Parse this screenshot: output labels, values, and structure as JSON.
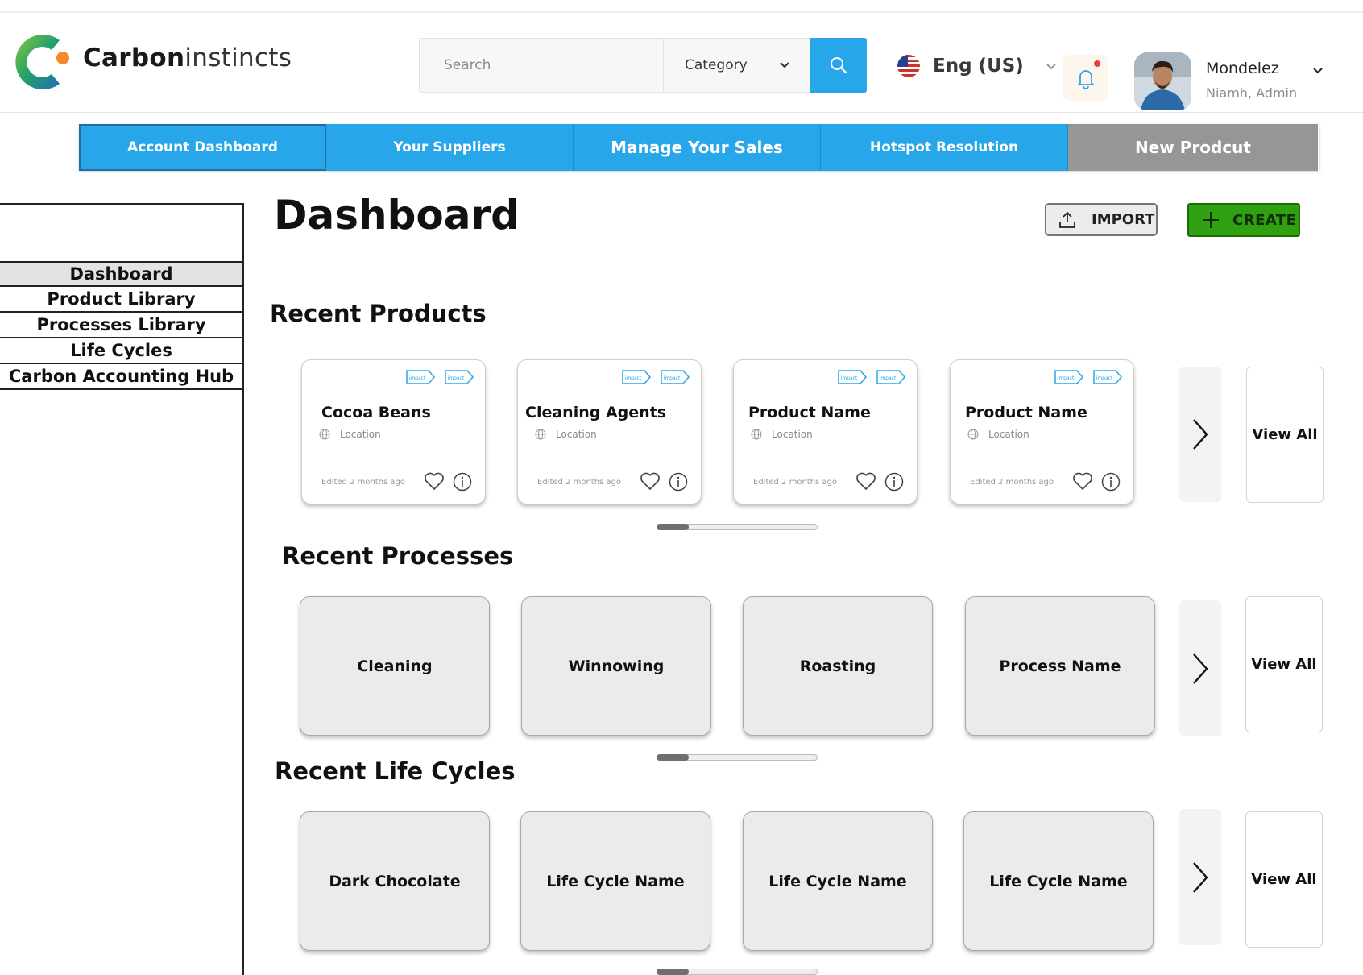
{
  "app": {
    "brand_bold": "Carbon",
    "brand_light": "instincts",
    "colors": {
      "primary": "#28a6ea",
      "create": "#2fa00f",
      "grey_tab": "#969696"
    }
  },
  "header": {
    "search": {
      "placeholder": "Search",
      "category_label": "Category"
    },
    "language": {
      "label": "Eng (US)",
      "flag_icon": "us-flag-icon"
    },
    "notifications": {
      "icon": "bell-icon",
      "has_unread": true
    },
    "user": {
      "name": "Mondelez",
      "role": "Niamh, Admin"
    }
  },
  "nav": {
    "tabs": [
      {
        "label": "Account Dashboard"
      },
      {
        "label": "Your Suppliers"
      },
      {
        "label": "Manage Your Sales"
      },
      {
        "label": "Hotspot Resolution"
      },
      {
        "label": "New Prodcut"
      }
    ]
  },
  "sidebar": {
    "items": [
      {
        "label": "Dashboard"
      },
      {
        "label": "Product Library"
      },
      {
        "label": "Processes Library"
      },
      {
        "label": "Life Cycles"
      },
      {
        "label": "Carbon Accounting Hub"
      }
    ]
  },
  "main": {
    "title": "Dashboard",
    "import_label": "IMPORT",
    "create_label": "CREATE",
    "view_all_label": "View All",
    "recent_products": {
      "title": "Recent Products",
      "tag_label": "impact",
      "items": [
        {
          "name": "Cocoa Beans",
          "location": "Location",
          "edited": "Edited 2 months ago"
        },
        {
          "name": "Cleaning Agents",
          "location": "Location",
          "edited": "Edited 2 months ago"
        },
        {
          "name": "Product Name",
          "location": "Location",
          "edited": "Edited 2 months ago"
        },
        {
          "name": "Product Name",
          "location": "Location",
          "edited": "Edited 2 months ago"
        }
      ]
    },
    "recent_processes": {
      "title": "Recent Processes",
      "items": [
        "Cleaning",
        "Winnowing",
        "Roasting",
        "Process Name"
      ]
    },
    "recent_life_cycles": {
      "title": "Recent Life Cycles",
      "items": [
        "Dark Chocolate",
        "Life Cycle Name",
        "Life Cycle Name",
        "Life Cycle Name"
      ]
    }
  }
}
